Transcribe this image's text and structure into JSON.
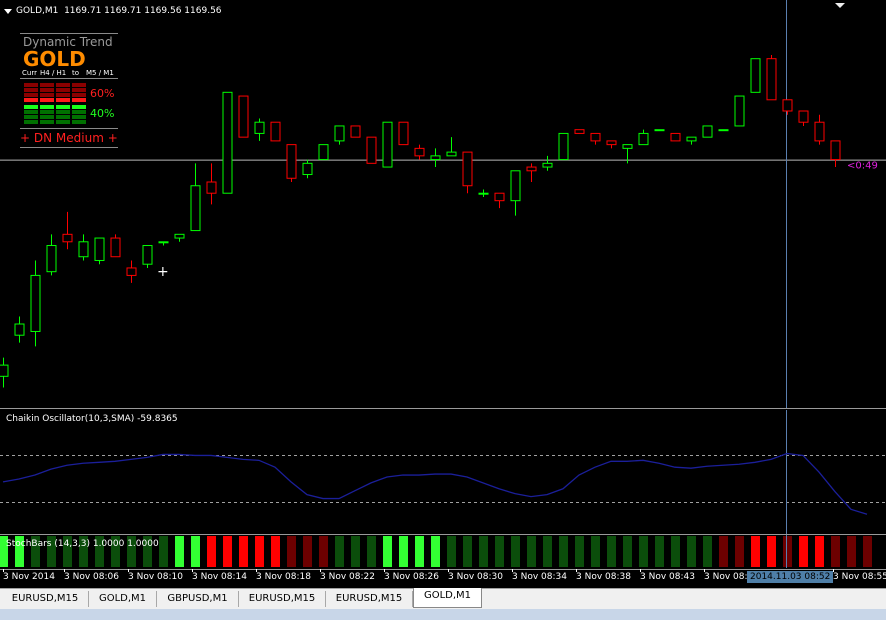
{
  "main_chart": {
    "header": "GOLD,M1  1169.71 1169.71 1169.56 1169.56",
    "current_price_line_label": "<0:49",
    "cursor_marker": "+",
    "candles": [
      {
        "o": 1169.15,
        "h": 1169.2,
        "l": 1169.12,
        "c": 1169.18
      },
      {
        "o": 1169.26,
        "h": 1169.31,
        "l": 1169.24,
        "c": 1169.29
      },
      {
        "o": 1169.27,
        "h": 1169.46,
        "l": 1169.23,
        "c": 1169.42
      },
      {
        "o": 1169.43,
        "h": 1169.53,
        "l": 1169.42,
        "c": 1169.5
      },
      {
        "o": 1169.53,
        "h": 1169.59,
        "l": 1169.49,
        "c": 1169.51
      },
      {
        "o": 1169.47,
        "h": 1169.53,
        "l": 1169.46,
        "c": 1169.51
      },
      {
        "o": 1169.46,
        "h": 1169.52,
        "l": 1169.45,
        "c": 1169.52
      },
      {
        "o": 1169.52,
        "h": 1169.53,
        "l": 1169.47,
        "c": 1169.47
      },
      {
        "o": 1169.44,
        "h": 1169.46,
        "l": 1169.4,
        "c": 1169.42
      },
      {
        "o": 1169.45,
        "h": 1169.5,
        "l": 1169.44,
        "c": 1169.5
      },
      {
        "o": 1169.51,
        "h": 1169.51,
        "l": 1169.5,
        "c": 1169.51
      },
      {
        "o": 1169.52,
        "h": 1169.53,
        "l": 1169.51,
        "c": 1169.53
      },
      {
        "o": 1169.54,
        "h": 1169.72,
        "l": 1169.54,
        "c": 1169.66
      },
      {
        "o": 1169.67,
        "h": 1169.72,
        "l": 1169.61,
        "c": 1169.64
      },
      {
        "o": 1169.64,
        "h": 1169.91,
        "l": 1169.64,
        "c": 1169.91
      },
      {
        "o": 1169.9,
        "h": 1169.9,
        "l": 1169.79,
        "c": 1169.79
      },
      {
        "o": 1169.8,
        "h": 1169.84,
        "l": 1169.78,
        "c": 1169.83
      },
      {
        "o": 1169.83,
        "h": 1169.83,
        "l": 1169.78,
        "c": 1169.78
      },
      {
        "o": 1169.77,
        "h": 1169.77,
        "l": 1169.67,
        "c": 1169.68
      },
      {
        "o": 1169.69,
        "h": 1169.73,
        "l": 1169.68,
        "c": 1169.72
      },
      {
        "o": 1169.73,
        "h": 1169.77,
        "l": 1169.73,
        "c": 1169.77
      },
      {
        "o": 1169.78,
        "h": 1169.82,
        "l": 1169.77,
        "c": 1169.82
      },
      {
        "o": 1169.82,
        "h": 1169.82,
        "l": 1169.79,
        "c": 1169.79
      },
      {
        "o": 1169.79,
        "h": 1169.79,
        "l": 1169.72,
        "c": 1169.72
      },
      {
        "o": 1169.71,
        "h": 1169.83,
        "l": 1169.71,
        "c": 1169.83
      },
      {
        "o": 1169.83,
        "h": 1169.83,
        "l": 1169.77,
        "c": 1169.77
      },
      {
        "o": 1169.76,
        "h": 1169.77,
        "l": 1169.73,
        "c": 1169.74
      },
      {
        "o": 1169.73,
        "h": 1169.76,
        "l": 1169.71,
        "c": 1169.74
      },
      {
        "o": 1169.74,
        "h": 1169.79,
        "l": 1169.74,
        "c": 1169.75
      },
      {
        "o": 1169.75,
        "h": 1169.75,
        "l": 1169.64,
        "c": 1169.66
      },
      {
        "o": 1169.64,
        "h": 1169.65,
        "l": 1169.63,
        "c": 1169.64
      },
      {
        "o": 1169.64,
        "h": 1169.64,
        "l": 1169.6,
        "c": 1169.62
      },
      {
        "o": 1169.62,
        "h": 1169.7,
        "l": 1169.58,
        "c": 1169.7
      },
      {
        "o": 1169.71,
        "h": 1169.72,
        "l": 1169.67,
        "c": 1169.7
      },
      {
        "o": 1169.71,
        "h": 1169.74,
        "l": 1169.7,
        "c": 1169.72
      },
      {
        "o": 1169.73,
        "h": 1169.8,
        "l": 1169.73,
        "c": 1169.8
      },
      {
        "o": 1169.81,
        "h": 1169.81,
        "l": 1169.8,
        "c": 1169.8
      },
      {
        "o": 1169.8,
        "h": 1169.8,
        "l": 1169.77,
        "c": 1169.78
      },
      {
        "o": 1169.78,
        "h": 1169.78,
        "l": 1169.76,
        "c": 1169.77
      },
      {
        "o": 1169.76,
        "h": 1169.77,
        "l": 1169.72,
        "c": 1169.77
      },
      {
        "o": 1169.77,
        "h": 1169.81,
        "l": 1169.77,
        "c": 1169.8
      },
      {
        "o": 1169.81,
        "h": 1169.81,
        "l": 1169.81,
        "c": 1169.81
      },
      {
        "o": 1169.8,
        "h": 1169.8,
        "l": 1169.78,
        "c": 1169.78
      },
      {
        "o": 1169.78,
        "h": 1169.78,
        "l": 1169.77,
        "c": 1169.79
      },
      {
        "o": 1169.79,
        "h": 1169.82,
        "l": 1169.79,
        "c": 1169.82
      },
      {
        "o": 1169.81,
        "h": 1169.81,
        "l": 1169.81,
        "c": 1169.81
      },
      {
        "o": 1169.82,
        "h": 1169.9,
        "l": 1169.82,
        "c": 1169.9
      },
      {
        "o": 1169.91,
        "h": 1170.0,
        "l": 1169.91,
        "c": 1170.0
      },
      {
        "o": 1170.0,
        "h": 1170.01,
        "l": 1169.89,
        "c": 1169.89
      },
      {
        "o": 1169.89,
        "h": 1169.89,
        "l": 1169.85,
        "c": 1169.86
      },
      {
        "o": 1169.86,
        "h": 1169.86,
        "l": 1169.82,
        "c": 1169.83
      },
      {
        "o": 1169.83,
        "h": 1169.85,
        "l": 1169.77,
        "c": 1169.78
      },
      {
        "o": 1169.78,
        "h": 1169.78,
        "l": 1169.71,
        "c": 1169.73
      }
    ]
  },
  "dynamic_trend": {
    "title": "Dynamic Trend",
    "symbol": "GOLD",
    "curr": "Curr",
    "tf_h4_h1": "H4 / H1",
    "to": "to",
    "tf_m5_m1": "M5 / M1",
    "pct_down": "60%",
    "pct_up": "40%",
    "state": "+ DN Medium +"
  },
  "oscillator": {
    "header": "Chaikin Oscillator(10,3,SMA) -59.8365",
    "values": [
      0.45,
      0.48,
      0.52,
      0.58,
      0.62,
      0.64,
      0.65,
      0.66,
      0.68,
      0.7,
      0.73,
      0.73,
      0.72,
      0.72,
      0.7,
      0.68,
      0.67,
      0.6,
      0.45,
      0.32,
      0.28,
      0.28,
      0.36,
      0.44,
      0.5,
      0.52,
      0.52,
      0.53,
      0.53,
      0.5,
      0.44,
      0.38,
      0.33,
      0.3,
      0.32,
      0.38,
      0.52,
      0.6,
      0.66,
      0.66,
      0.67,
      0.64,
      0.6,
      0.59,
      0.61,
      0.62,
      0.63,
      0.65,
      0.68,
      0.74,
      0.72,
      0.55,
      0.35,
      0.17,
      0.12
    ]
  },
  "stochbars": {
    "header": "StochBars (14,3,3) 1.0000 1.0000",
    "bars": [
      "lime",
      "lime",
      "dg",
      "dg",
      "dg",
      "dg",
      "dg",
      "dg",
      "dg",
      "dg",
      "dg",
      "lime",
      "lime",
      "red",
      "red",
      "red",
      "red",
      "red",
      "dr",
      "dr",
      "dr",
      "dg",
      "dg",
      "dg",
      "lime",
      "lime",
      "lime",
      "lime",
      "dg",
      "dg",
      "dg",
      "dg",
      "dg",
      "dg",
      "dg",
      "dg",
      "dg",
      "dg",
      "dg",
      "dg",
      "dg",
      "dg",
      "dg",
      "dg",
      "dg",
      "dr",
      "dr",
      "red",
      "red",
      "dr",
      "red",
      "red",
      "dr",
      "dr",
      "dr"
    ]
  },
  "time_axis": {
    "labels": [
      "3 Nov 2014",
      "3 Nov 08:06",
      "3 Nov 08:10",
      "3 Nov 08:14",
      "3 Nov 08:18",
      "3 Nov 08:22",
      "3 Nov 08:26",
      "3 Nov 08:30",
      "3 Nov 08:34",
      "3 Nov 08:38",
      "3 Nov 08:43",
      "3 Nov 08:",
      "3 Nov 08:55"
    ],
    "crosshair_time": "2014.11.03 08:52"
  },
  "tabs": [
    {
      "label": "EURUSD,M15",
      "active": false
    },
    {
      "label": "GOLD,M1",
      "active": false
    },
    {
      "label": "GBPUSD,M1",
      "active": false
    },
    {
      "label": "EURUSD,M15",
      "active": false
    },
    {
      "label": "EURUSD,M15",
      "active": false
    },
    {
      "label": "GOLD,M1",
      "active": true
    }
  ],
  "colors": {
    "bull": "#00ff00",
    "bear": "#ff0000",
    "osc_line": "#1b1f9a",
    "dashed": "#a0a0a0",
    "crosshair": "#5a7fb0",
    "price_label": "#e020e0"
  }
}
